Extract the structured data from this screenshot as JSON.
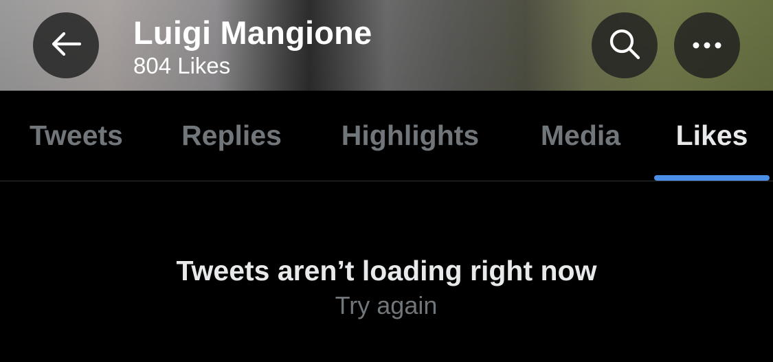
{
  "header": {
    "name": "Luigi Mangione",
    "likes_count": "804 Likes",
    "back_icon": "arrow-left-icon",
    "search_icon": "search-icon",
    "more_icon": "more-horizontal-icon"
  },
  "tabs": [
    {
      "label": "Tweets",
      "active": false
    },
    {
      "label": "Replies",
      "active": false
    },
    {
      "label": "Highlights",
      "active": false
    },
    {
      "label": "Media",
      "active": false
    },
    {
      "label": "Likes",
      "active": true
    }
  ],
  "empty_state": {
    "title": "Tweets aren’t loading right now",
    "action": "Try again"
  },
  "colors": {
    "background": "#000000",
    "text_primary": "#e7e9ea",
    "text_secondary": "#71767b",
    "accent": "#4a8ee8",
    "divider": "#2f3336"
  }
}
